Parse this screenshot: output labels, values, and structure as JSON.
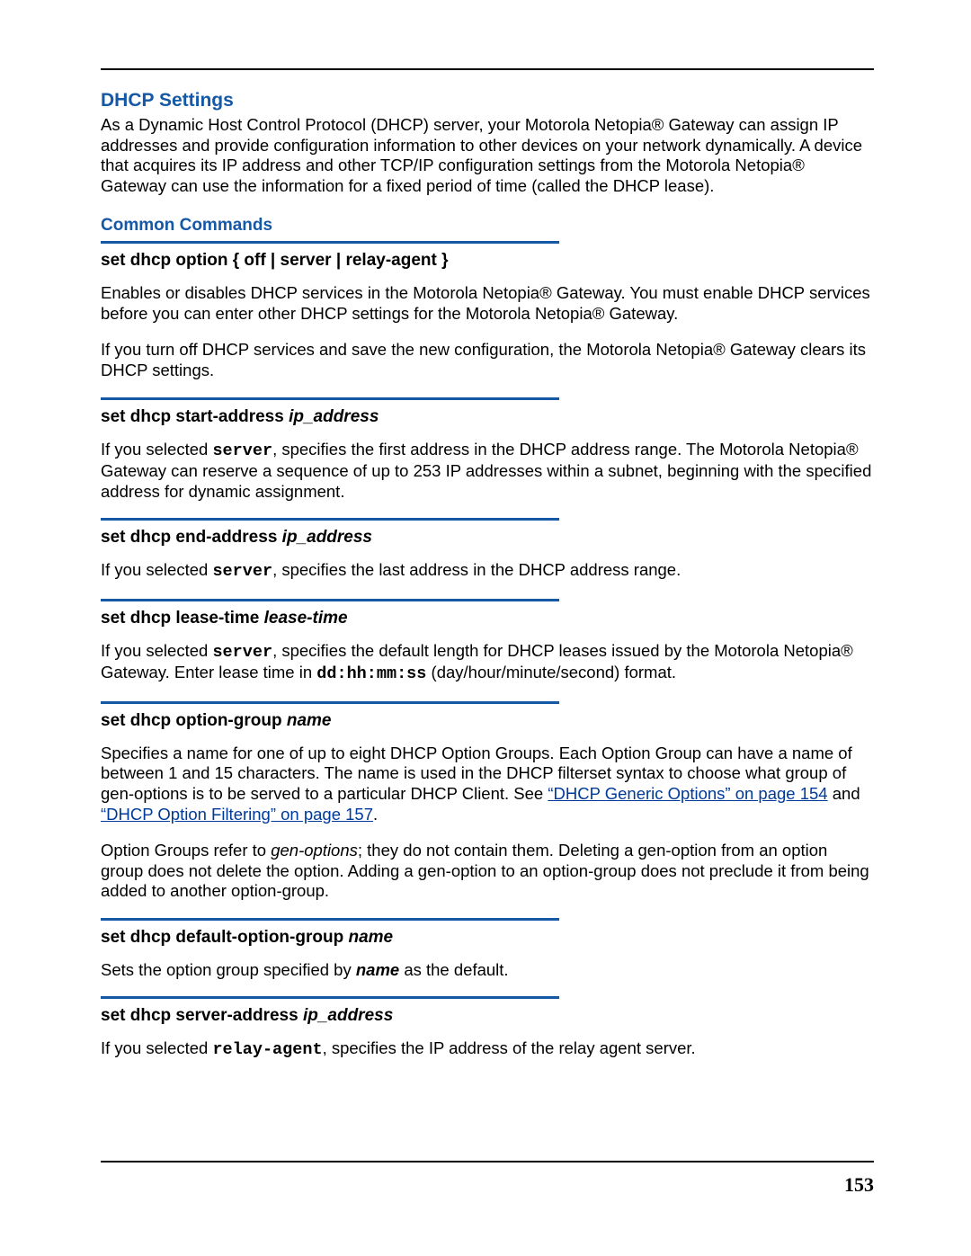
{
  "page_number": "153",
  "title": "DHCP Settings",
  "intro": "As a Dynamic Host Control Protocol (DHCP) server, your Motorola Netopia® Gateway can assign IP addresses and provide configuration information to other devices on your network dynamically. A device that acquires its IP address and other TCP/IP configuration settings from the Motorola Netopia® Gateway can use the information for a fixed period of time (called the DHCP lease).",
  "subhead": "Common Commands",
  "cmds": [
    {
      "head_plain": "set dhcp option { off | server | relay-agent }",
      "head_param": "",
      "desc_before": "Enables or disables DHCP services in the Motorola Netopia® Gateway. You must enable DHCP services before you can enter other DHCP settings for the Motorola Netopia® Gateway.",
      "desc_extra": "If you turn off DHCP services and save the new configuration, the Motorola Netopia® Gateway clears its DHCP settings."
    },
    {
      "head_plain": "set dhcp start-address ",
      "head_param": "ip_address",
      "pre": "If you selected  ",
      "mono": "server",
      "post": ", specifies the first address in the DHCP address range. The Motorola Netopia® Gateway can reserve a sequence of up to 253 IP addresses within a subnet, beginning with the specified address for dynamic assignment."
    },
    {
      "head_plain": "set dhcp end-address ",
      "head_param": "ip_address",
      "pre": "If you selected ",
      "mono": "server",
      "post": ", specifies the last address in the DHCP address range."
    },
    {
      "head_plain": "set dhcp lease-time ",
      "head_param": "lease-time",
      "pre": "If you selected ",
      "mono": "server",
      "post_a": ", specifies the default length for DHCP leases issued by the Motorola Netopia® Gateway. Enter lease time in ",
      "mono2": "dd:hh:mm:ss",
      "post_b": " (day/hour/minute/second) format."
    },
    {
      "head_plain": "set dhcp option-group ",
      "head_param": "name",
      "desc_before": "Specifies a name for one of up to eight DHCP Option Groups. Each Option Group can have a name of between 1 and 15 characters. The name is used in the DHCP filterset syntax to choose what group of gen-options is to be served to a particular DHCP Client. See ",
      "link1": "“DHCP Generic Options” on page 154",
      "mid": " and ",
      "link2": "“DHCP Option Filtering” on page 157",
      "after": ".",
      "para2_a": "Option Groups refer to ",
      "para2_i": "gen-options",
      "para2_b": "; they do not contain them. Deleting a gen-option from an option group does not delete the option. Adding a gen-option to an option-group does not preclude it from being added to another option-group."
    },
    {
      "head_plain": "set dhcp default-option-group ",
      "head_param": "name",
      "pre": "Sets the option group specified by ",
      "bolditalic": "name",
      "post": " as the default."
    },
    {
      "head_plain": "set dhcp server-address ",
      "head_param": "ip_address",
      "pre": "If you selected  ",
      "mono": "relay-agent",
      "post": ", specifies the IP address of the relay agent server."
    }
  ]
}
